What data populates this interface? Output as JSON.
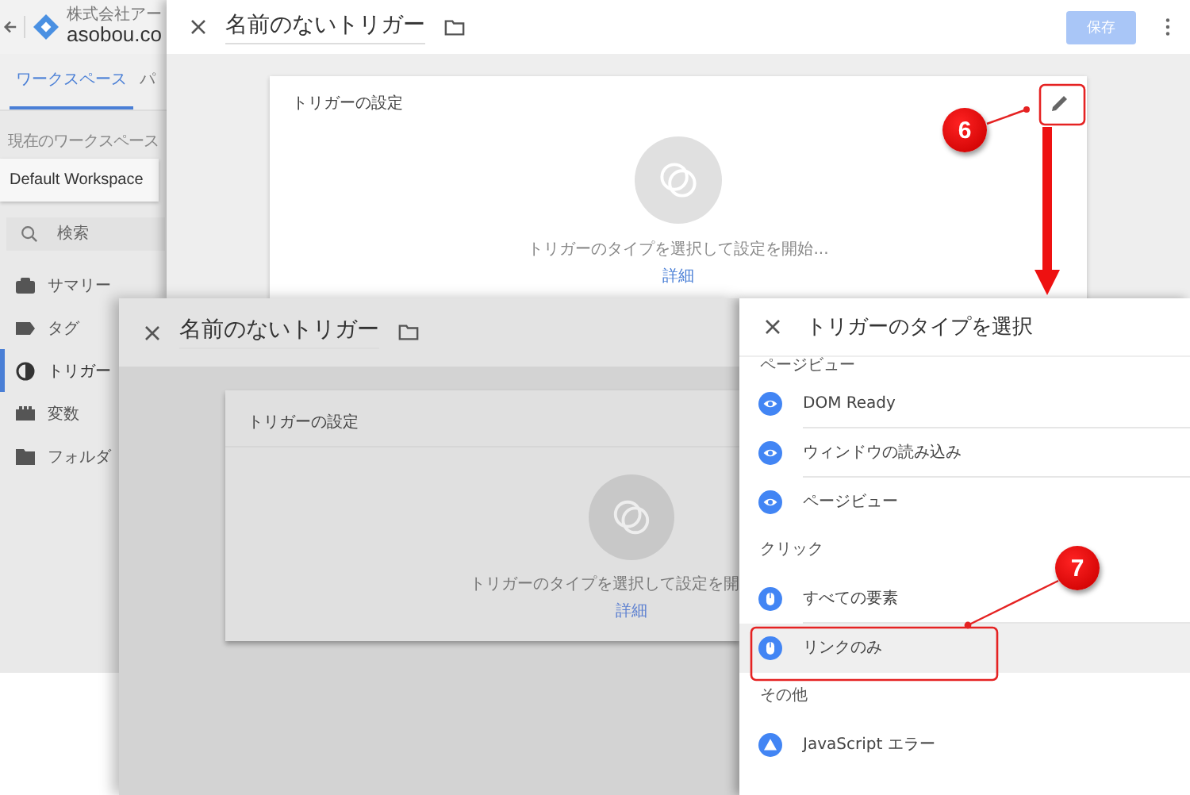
{
  "app": {
    "company": "株式会社アー",
    "account": "asobou.co",
    "tabs": [
      {
        "label": "ワークスペース",
        "selected": true
      },
      {
        "label": "パ",
        "selected": false
      }
    ],
    "workspace_label": "現在のワークスペース",
    "workspace": "Default Workspace",
    "search": {
      "placeholder": "検索"
    },
    "nav": [
      {
        "label": "サマリー",
        "kind": "summary",
        "selected": false
      },
      {
        "label": "タグ",
        "kind": "tag",
        "selected": false
      },
      {
        "label": "トリガー",
        "kind": "trigger",
        "selected": true
      },
      {
        "label": "変数",
        "kind": "variable",
        "selected": false
      },
      {
        "label": "フォルダ",
        "kind": "folder",
        "selected": false
      }
    ]
  },
  "editor": {
    "title": "名前のないトリガー",
    "save_button": "保存",
    "save_disabled": true,
    "card": {
      "title": "トリガーの設定",
      "prompt": "トリガーのタイプを選択して設定を開始...",
      "link": "詳細"
    }
  },
  "editor_behind": {
    "title": "名前のないトリガー",
    "card": {
      "title": "トリガーの設定",
      "prompt": "トリガーのタイプを選択して設定を開",
      "link": "詳細"
    }
  },
  "type_panel": {
    "title": "トリガーのタイプを選択",
    "groups": [
      {
        "heading": "ページビュー",
        "items": [
          {
            "label": "DOM Ready",
            "kind": "pageview",
            "selected": false
          },
          {
            "label": "ウィンドウの読み込み",
            "kind": "pageview",
            "selected": false
          },
          {
            "label": "ページビュー",
            "kind": "pageview",
            "selected": false
          }
        ]
      },
      {
        "heading": "クリック",
        "items": [
          {
            "label": "すべての要素",
            "kind": "click",
            "selected": false
          },
          {
            "label": "リンクのみ",
            "kind": "click",
            "selected": true
          }
        ]
      },
      {
        "heading": "その他",
        "items": [
          {
            "label": "JavaScript エラー",
            "kind": "error",
            "selected": false
          }
        ]
      }
    ]
  },
  "annotations": [
    {
      "number": "6"
    },
    {
      "number": "7"
    }
  ]
}
